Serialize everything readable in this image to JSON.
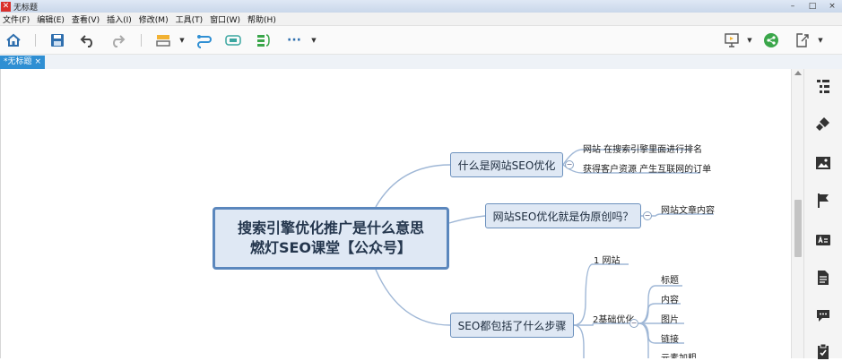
{
  "window": {
    "title": "无标题",
    "controls": [
      "–",
      "□",
      "×"
    ]
  },
  "menu": [
    "文件(F)",
    "编辑(E)",
    "查看(V)",
    "插入(I)",
    "修改(M)",
    "工具(T)",
    "窗口(W)",
    "帮助(H)"
  ],
  "toolbar": {
    "more_label": "···"
  },
  "tab": {
    "label": "*无标题",
    "close": "×"
  },
  "mindmap": {
    "root_line1": "搜索引擎优化推广是什么意思",
    "root_line2": "燃灯SEO课堂【公众号】",
    "branch1": {
      "label": "什么是网站SEO优化",
      "leaves": [
        "网站 在搜索引擎里面进行排名",
        "获得客户资源 产生互联网的订单"
      ]
    },
    "branch2": {
      "label": "网站SEO优化就是伪原创吗？",
      "leaves": [
        "网站文章内容"
      ]
    },
    "branch3": {
      "label": "SEO都包括了什么步骤",
      "sub1": "1 网站",
      "sub2": "2基础优化",
      "sub2_leaves": [
        "标题",
        "内容",
        "图片",
        "链接",
        "元素加粗"
      ]
    },
    "collapse_symbol": "−"
  },
  "colors": {
    "accent": "#2f8fd3",
    "node_fill": "#dfe8f4",
    "node_border": "#5b87bd",
    "line": "#9fb7d6"
  }
}
